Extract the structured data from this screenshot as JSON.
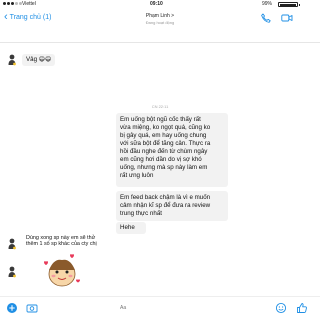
{
  "status_bar": {
    "carrier": "Viettel",
    "time": "09:10",
    "battery": "99%"
  },
  "header": {
    "back_label": "Trang chủ (1)",
    "contact_name": "Phạm Linh >",
    "contact_status": "Đang hoạt động"
  },
  "messages": {
    "reply_1": "Vâg",
    "timestamp": "CN 22:11",
    "long_message": [
      "Em uống bột ngũ cốc thấy rất",
      "vừa miệng, ko ngọt quá, cũng ko",
      "bị gây quá, em hay uống chung",
      "với sữa bột để tăng cân. Thực ra",
      "hồi đầu nghe đến từ chùm ngây",
      "em cũng hơi dần do vị sợ khó",
      "uống, nhưng mà sp này làm em",
      "rất ưng luôn"
    ],
    "feedback_message": [
      "Em feed back chậm là vì e muốn",
      "cảm nhận kĩ sp để đưa ra review",
      "trung thực nhất"
    ],
    "short_message": "Hehe",
    "final_message": [
      "Dùng xong sp này em sẽ thử",
      "thêm 1 số sp khác của cty chị"
    ]
  },
  "bottom_bar": {
    "input_placeholder": "Aa"
  },
  "colors": {
    "accent": "#1f8fe5",
    "bubble": "#f2f2f2"
  },
  "icons": [
    "chevron-left-icon",
    "phone-icon",
    "video-icon",
    "emoji-icon",
    "camera-icon",
    "add-icon",
    "smile-icon",
    "like-icon"
  ]
}
